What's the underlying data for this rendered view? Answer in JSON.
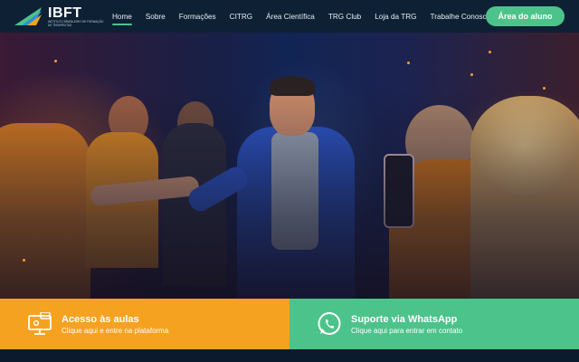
{
  "brand": {
    "name": "IBFT",
    "tagline": "Instituto Brasileiro de Formação de Terapeutas",
    "logo_icon": "ibft-logo-icon",
    "accent_green": "#4cc38a",
    "accent_orange": "#f5a221"
  },
  "nav": {
    "items": [
      {
        "label": "Home",
        "active": true
      },
      {
        "label": "Sobre",
        "active": false
      },
      {
        "label": "Formações",
        "active": false
      },
      {
        "label": "CITRG",
        "active": false
      },
      {
        "label": "Área Científica",
        "active": false
      },
      {
        "label": "TRG Club",
        "active": false
      },
      {
        "label": "Loja da TRG",
        "active": false
      },
      {
        "label": "Trabalhe Conosco",
        "active": false
      }
    ],
    "cta_label": "Área do aluno"
  },
  "panels": [
    {
      "title": "Acesso às aulas",
      "subtitle": "Clique aqui e entre na plataforma",
      "icon": "computer-classroom-icon",
      "color": "#f5a221"
    },
    {
      "title": "Suporte via WhatsApp",
      "subtitle": "Clique aqui para entrar em contato",
      "icon": "whatsapp-icon",
      "color": "#4cc38a"
    }
  ]
}
